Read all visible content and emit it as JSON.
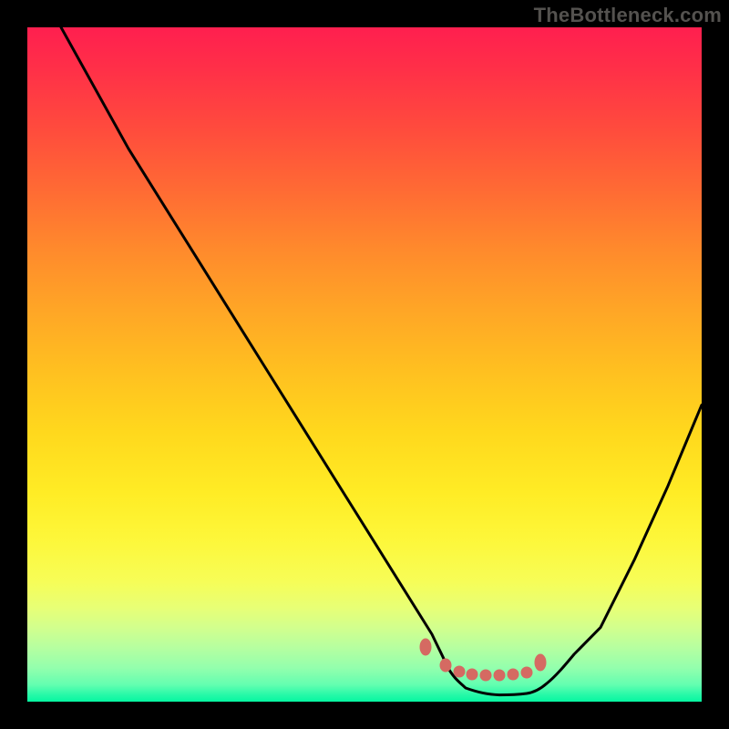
{
  "watermark": "TheBottleneck.com",
  "chart_data": {
    "type": "line",
    "title": "",
    "xlabel": "",
    "ylabel": "",
    "xlim": [
      0,
      100
    ],
    "ylim": [
      0,
      100
    ],
    "grid": false,
    "legend": false,
    "series": [
      {
        "name": "bottleneck-curve",
        "color": "#000000",
        "x": [
          5,
          10,
          15,
          20,
          25,
          30,
          35,
          40,
          45,
          50,
          55,
          60,
          62,
          64,
          66,
          68,
          70,
          72,
          74,
          76,
          80,
          85,
          90,
          95,
          100
        ],
        "y": [
          100,
          91,
          82,
          74,
          66,
          58,
          50,
          42,
          34,
          26,
          18,
          10,
          7,
          5,
          3,
          2,
          1.2,
          1,
          1,
          1.2,
          4,
          11,
          21,
          32,
          44
        ]
      },
      {
        "name": "optimal-band-markers",
        "color": "#d56a62",
        "type": "scatter",
        "x": [
          59,
          62,
          64,
          66,
          68,
          70,
          72,
          74,
          76
        ],
        "y": [
          8,
          8,
          8,
          8,
          8,
          8,
          8,
          8,
          8
        ]
      }
    ],
    "colors": {
      "gradient_top": "#ff1f4f",
      "gradient_mid": "#ffd81d",
      "gradient_bottom": "#06f6a1",
      "marker": "#d56a62",
      "curve": "#000000",
      "frame": "#000000"
    }
  }
}
